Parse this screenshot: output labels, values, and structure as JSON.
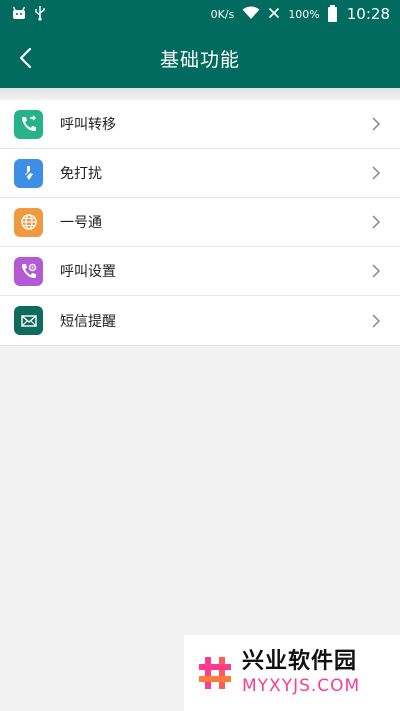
{
  "status_bar": {
    "network_speed": "0K/s",
    "battery": "100%",
    "time": "10:28"
  },
  "header": {
    "title": "基础功能"
  },
  "menu": {
    "items": [
      {
        "label": "呼叫转移",
        "icon": "call-forward-icon",
        "color": "#27b38a"
      },
      {
        "label": "免打扰",
        "icon": "do-not-disturb-icon",
        "color": "#3d8fe6"
      },
      {
        "label": "一号通",
        "icon": "globe-icon",
        "color": "#ef9a3e"
      },
      {
        "label": "呼叫设置",
        "icon": "call-settings-icon",
        "color": "#b35ad4"
      },
      {
        "label": "短信提醒",
        "icon": "sms-envelope-icon",
        "color": "#0f6b5e"
      }
    ]
  },
  "watermark": {
    "cn": "兴业软件园",
    "en": "MYXYJS.COM"
  },
  "colors": {
    "primary": "#006b5e",
    "background": "#f2f2f2",
    "watermark_accent": "#ff3b8d"
  }
}
